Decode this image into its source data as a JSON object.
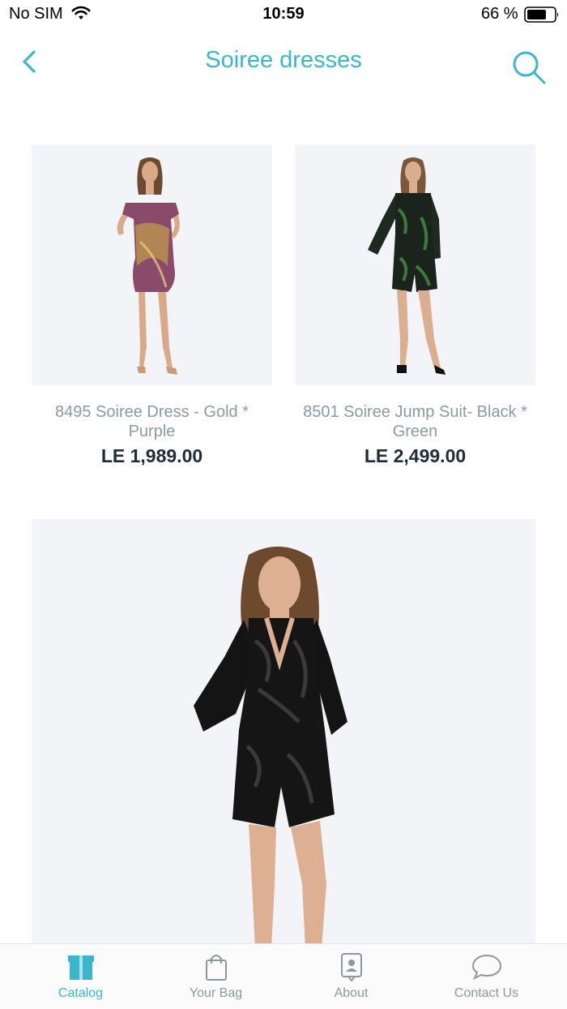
{
  "status": {
    "carrier": "No SIM",
    "time": "10:59",
    "battery": "66 %"
  },
  "nav": {
    "title": "Soiree dresses"
  },
  "products": [
    {
      "name": "8495 Soiree Dress - Gold * Purple",
      "price": "LE 1,989.00",
      "image": "model in strapless sequin mini dress, gold and purple"
    },
    {
      "name": "8501 Soiree Jump Suit-  Black * Green",
      "price": "LE 2,499.00",
      "image": "model in long-sleeve sequin jumpsuit, black and green"
    },
    {
      "image": "model in long-sleeve black sequin playsuit"
    }
  ],
  "tabs": [
    {
      "label": "Catalog",
      "icon": "catalog-box-icon",
      "active": true
    },
    {
      "label": "Your Bag",
      "icon": "shopping-bag-icon",
      "active": false
    },
    {
      "label": "About",
      "icon": "about-contact-card-icon",
      "active": false
    },
    {
      "label": "Contact Us",
      "icon": "chat-bubble-icon",
      "active": false
    }
  ],
  "colors": {
    "accent": "#3cb6cd",
    "price": "#1f2d3a",
    "name": "#8a9aa6",
    "image_bg": "#f3f4f7"
  }
}
